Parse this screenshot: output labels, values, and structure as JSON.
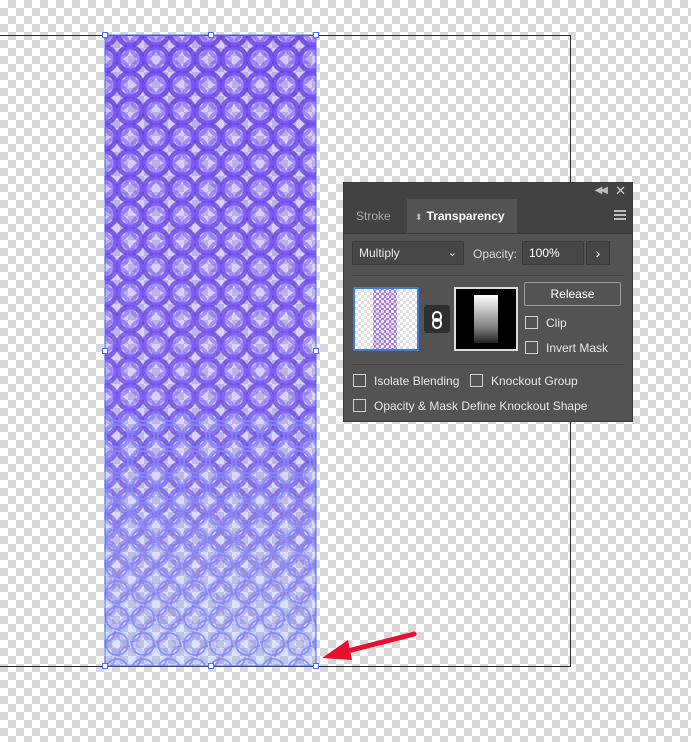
{
  "panel": {
    "tabs": [
      {
        "label": "Stroke"
      },
      {
        "label": "Transparency"
      }
    ],
    "blend_mode": "Multiply",
    "opacity_label": "Opacity:",
    "opacity_value": "100%",
    "release_label": "Release",
    "clip_label": "Clip",
    "invert_mask_label": "Invert Mask",
    "isolate_blending_label": "Isolate Blending",
    "knockout_group_label": "Knockout Group",
    "opacity_mask_knockout_label": "Opacity & Mask Define Knockout Shape"
  },
  "icons": {
    "collapse": "double-chevron-left-icon",
    "close": "close-icon",
    "menu": "hamburger-menu-icon",
    "link": "link-icon",
    "annotation_arrow": "red-arrow-icon"
  },
  "colors": {
    "pattern_top": "#6a3ff0",
    "pattern_bottom": "#7aa0f5",
    "selection": "#4a6cf7",
    "arrow": "#e8102f",
    "panel_bg": "#535353"
  }
}
